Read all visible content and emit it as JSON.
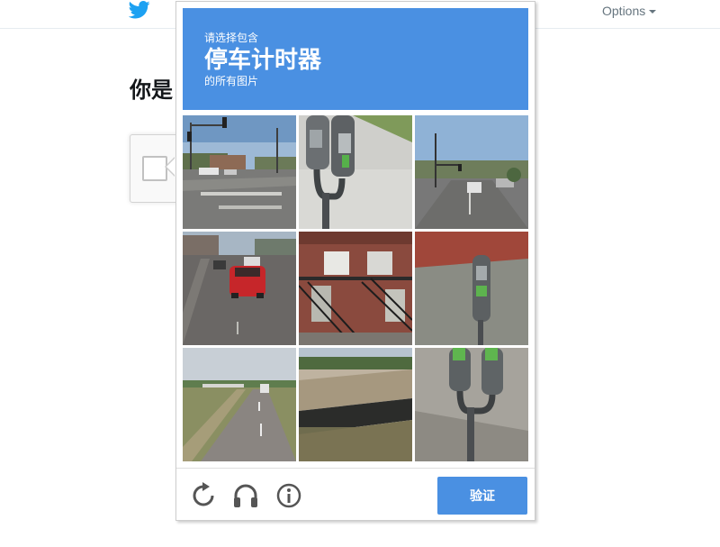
{
  "topbar": {
    "logo_icon": "twitter-bird-icon",
    "options_label": "Options"
  },
  "page": {
    "heading": "你是"
  },
  "challenge": {
    "header": {
      "line1": "请选择包含",
      "keyword": "停车计时器",
      "line3": "的所有图片",
      "background": "#4a90e2"
    },
    "tiles": [
      {
        "subject": "street intersection with traffic lights"
      },
      {
        "subject": "parking meter close-up"
      },
      {
        "subject": "city street with traffic light"
      },
      {
        "subject": "road with red car"
      },
      {
        "subject": "apartment building with stairs"
      },
      {
        "subject": "parking meter on sidewalk"
      },
      {
        "subject": "highway"
      },
      {
        "subject": "bridge underpass"
      },
      {
        "subject": "double parking meter"
      }
    ],
    "footer": {
      "reload_icon": "reload-icon",
      "audio_icon": "headphones-icon",
      "info_icon": "info-icon",
      "verify_label": "验证"
    }
  },
  "colors": {
    "accent": "#4a90e2",
    "twitter_blue": "#1da1f2"
  }
}
